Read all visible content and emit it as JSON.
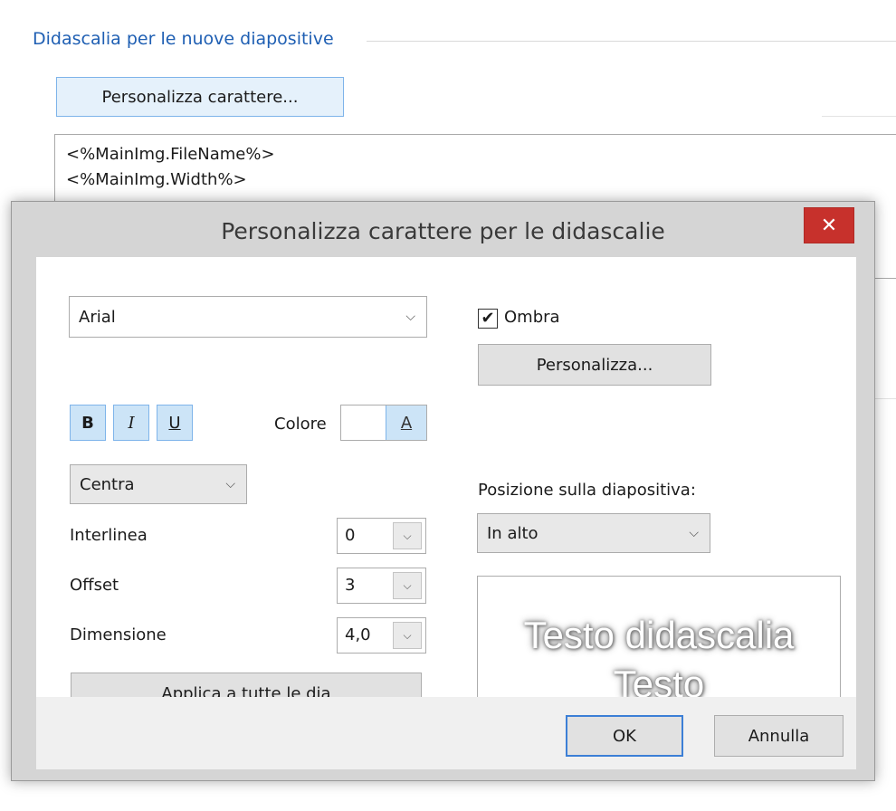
{
  "background": {
    "group_title": "Didascalia per le nuove diapositive",
    "customize_font_button": "Personalizza carattere...",
    "caption_lines": [
      "<%MainImg.FileName%>",
      "<%MainImg.Width%>"
    ]
  },
  "dialog": {
    "title": "Personalizza carattere per le didascalie",
    "close_glyph": "✕",
    "font": {
      "selected": "Arial"
    },
    "style_buttons": {
      "bold": "B",
      "italic": "I",
      "underline": "U"
    },
    "color": {
      "label": "Colore",
      "button_glyph": "A"
    },
    "alignment": {
      "selected": "Centra"
    },
    "line_spacing": {
      "label": "Interlinea",
      "value": "0"
    },
    "offset": {
      "label": "Offset",
      "value": "3"
    },
    "size": {
      "label": "Dimensione",
      "value": "4,0"
    },
    "apply_all_button": "Applica a tutte le dia",
    "shadow": {
      "label": "Ombra",
      "checked": true,
      "check_glyph": "✔"
    },
    "customize_button": "Personalizza...",
    "position": {
      "label": "Posizione sulla diapositiva:",
      "selected": "In alto"
    },
    "preview": {
      "line1": "Testo didascalia",
      "line2": "Testo"
    },
    "ok_button": "OK",
    "cancel_button": "Annulla"
  },
  "icons": {
    "dropdown": "chevron-down-icon",
    "close": "close-icon",
    "check": "checkmark-icon"
  },
  "colors": {
    "accent": "#1f5fb3",
    "close_button": "#c7312c",
    "selection": "#cce4f7"
  }
}
